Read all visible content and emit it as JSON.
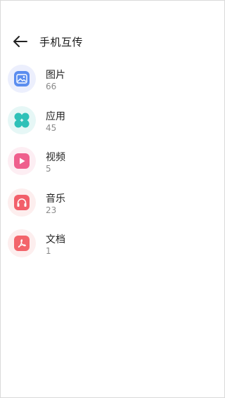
{
  "header": {
    "title": "手机互传",
    "back_icon": "back-arrow-icon"
  },
  "categories": [
    {
      "label": "图片",
      "count": "66",
      "icon": "image-icon",
      "color": "#5b8def",
      "bg": "#eceffd"
    },
    {
      "label": "应用",
      "count": "45",
      "icon": "app-grid-icon",
      "color": "#2fc1b8",
      "bg": "#e6f7f6"
    },
    {
      "label": "视频",
      "count": "5",
      "icon": "play-icon",
      "color": "#ef5f8d",
      "bg": "#fdeef3"
    },
    {
      "label": "音乐",
      "count": "23",
      "icon": "headphones-icon",
      "color": "#f25f6a",
      "bg": "#fdeeee"
    },
    {
      "label": "文档",
      "count": "1",
      "icon": "pdf-icon",
      "color": "#f3656b",
      "bg": "#fdeeee"
    }
  ]
}
